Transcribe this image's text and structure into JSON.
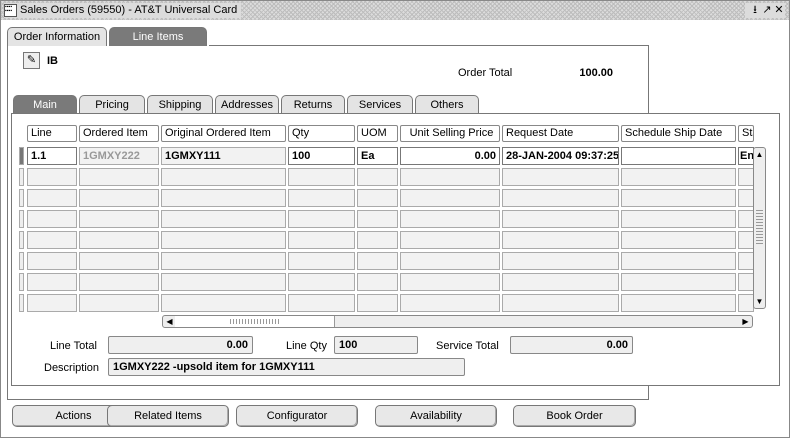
{
  "window": {
    "title": "Sales Orders (59550) - AT&T Universal Card",
    "controls": [
      "⭳",
      "↗",
      "✕"
    ]
  },
  "top_tabs": [
    "Order Information",
    "Line Items"
  ],
  "header": {
    "ib_label": "IB",
    "order_total_label": "Order Total",
    "order_total_value": "100.00"
  },
  "sub_tabs": [
    "Main",
    "Pricing",
    "Shipping",
    "Addresses",
    "Returns",
    "Services",
    "Others"
  ],
  "table": {
    "columns": [
      "Line",
      "Ordered Item",
      "Original Ordered Item",
      "Qty",
      "UOM",
      "Unit Selling Price",
      "Request Date",
      "Schedule Ship Date",
      "Sta"
    ],
    "rows": [
      [
        "1.1",
        "1GMXY222",
        "1GMXY111",
        "100",
        "Ea",
        "0.00",
        "28-JAN-2004 09:37:25",
        "",
        "En"
      ]
    ]
  },
  "totals": {
    "line_total_label": "Line Total",
    "line_total_value": "0.00",
    "line_qty_label": "Line Qty",
    "line_qty_value": "100",
    "service_total_label": "Service Total",
    "service_total_value": "0.00",
    "description_label": "Description",
    "description_value": "1GMXY222 -upsold item for 1GMXY111"
  },
  "buttons": {
    "actions": "Actions",
    "related_items": "Related Items",
    "configurator": "Configurator",
    "availability": "Availability",
    "book_order": "Book Order"
  }
}
